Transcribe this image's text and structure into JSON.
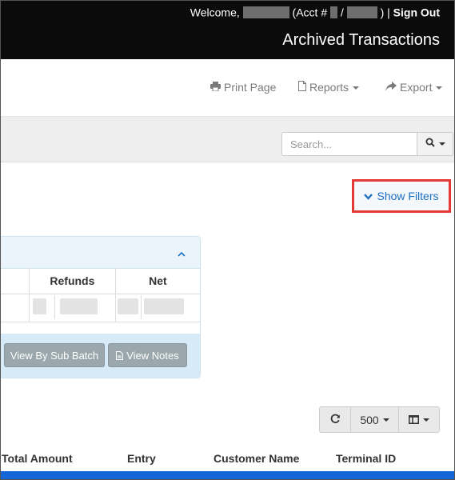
{
  "header": {
    "welcome_prefix": "Welcome,",
    "acct_prefix": "(Acct #",
    "slash": "/",
    "close_paren": ")",
    "divider": "|",
    "sign_out": "Sign Out",
    "title": "Archived Transactions"
  },
  "toolbar": {
    "print": "Print Page",
    "reports": "Reports",
    "export": "Export"
  },
  "search": {
    "placeholder": "Search..."
  },
  "filters": {
    "show_filters": "Show Filters"
  },
  "summary": {
    "columns": [
      "Refunds",
      "Net"
    ],
    "buttons": {
      "view_by_sub_batch": "View By Sub Batch",
      "view_notes": "View Notes"
    }
  },
  "table_controls": {
    "page_size": "500"
  },
  "table": {
    "columns": [
      "Total Amount",
      "Entry",
      "Customer Name",
      "Terminal ID"
    ]
  },
  "colors": {
    "header_bg": "#0b0b0b",
    "link_blue": "#1c6fc4",
    "highlight_red": "#e53935",
    "row_blue": "#1466d6"
  }
}
